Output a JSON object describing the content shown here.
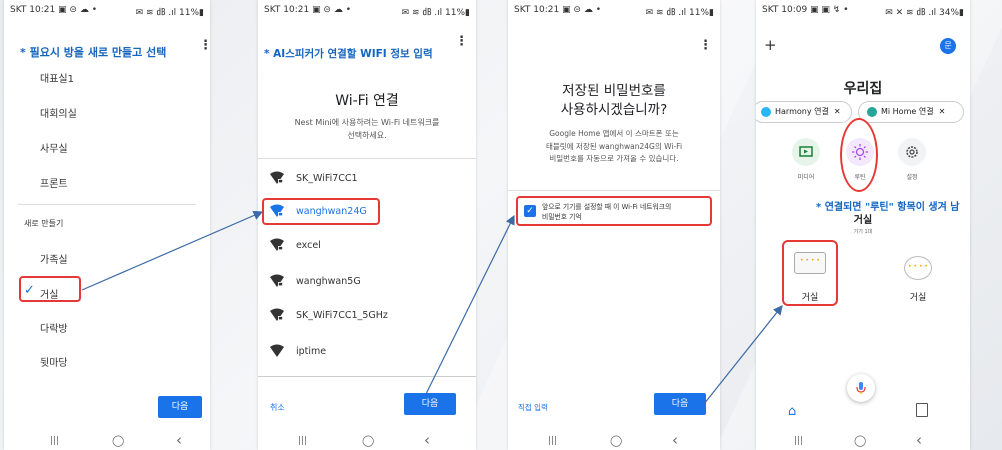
{
  "phone1": {
    "status_left": "SKT 10:21 ▣ ⊝ ☁ •",
    "status_right": "✉ ≋ ㏈ .ıl 11%▮",
    "annotation": "* 필요시 방을 새로 만들고 선택",
    "rooms": [
      "대표실1",
      "대회의실",
      "사무실",
      "프론트"
    ],
    "new_section": "새로 만들기",
    "new_rooms": [
      "가족실",
      "거실",
      "다락방",
      "뒷마당"
    ],
    "selected_check": "✓",
    "next": "다음"
  },
  "phone2": {
    "status_left": "SKT 10:21 ▣ ⊝ ☁ •",
    "status_right": "✉ ≋ ㏈ .ıl 11%▮",
    "annotation": "* AI스피커가 연결할 WIFI 정보 입력",
    "title": "Wi-Fi 연결",
    "subtitle_line1": "Nest Mini에 사용하려는 Wi-Fi 네트워크를",
    "subtitle_line2": "선택하세요.",
    "networks": [
      "SK_WiFi7CC1",
      "wanghwan24G",
      "excel",
      "wanghwan5G",
      "SK_WiFi7CC1_5GHz",
      "iptime"
    ],
    "cancel": "취소",
    "next": "다음"
  },
  "phone3": {
    "status_left": "SKT 10:21 ▣ ⊝ ☁ •",
    "status_right": "✉ ≋ ㏈ .ıl 11%▮",
    "title_line1": "저장된 비밀번호를",
    "title_line2": "사용하시겠습니까?",
    "body_line1": "Google Home 앱에서 이 스마트폰 또는",
    "body_line2": "태블릿에 저장된 wanghwan24G의 Wi-Fi",
    "body_line3": "비밀번호를 자동으로 가져올 수 있습니다.",
    "checkbox_line1": "앞으로 기기를 설정할 때 이 Wi-Fi 네트워크의",
    "checkbox_line2": "비밀번호 기억",
    "manual": "직접 입력",
    "next": "다음"
  },
  "phone4": {
    "status_left": "SKT 10:09 ▣ ▣ ↯ •",
    "status_right": "✉ ✕ ≋ ㏈ .ıl 34%▮",
    "plus": "+",
    "avatar": "문",
    "home_title": "우리집",
    "chip1": "Harmony 연결",
    "chip2": "Mi Home 연결",
    "actions": [
      "미디어",
      "루틴",
      "설정"
    ],
    "annotation": "* 연결되면 \"루틴\" 항목이 생겨 남",
    "room_title": "거실",
    "room_sub": "기기 1대",
    "device1": "거실",
    "device2": "거실"
  },
  "nav": {
    "recent": "|||",
    "home": "◯",
    "back": "‹"
  },
  "colors": {
    "accent_blue": "#1a73e8",
    "annotation_blue": "#1565c0",
    "highlight_red": "#e53935"
  }
}
